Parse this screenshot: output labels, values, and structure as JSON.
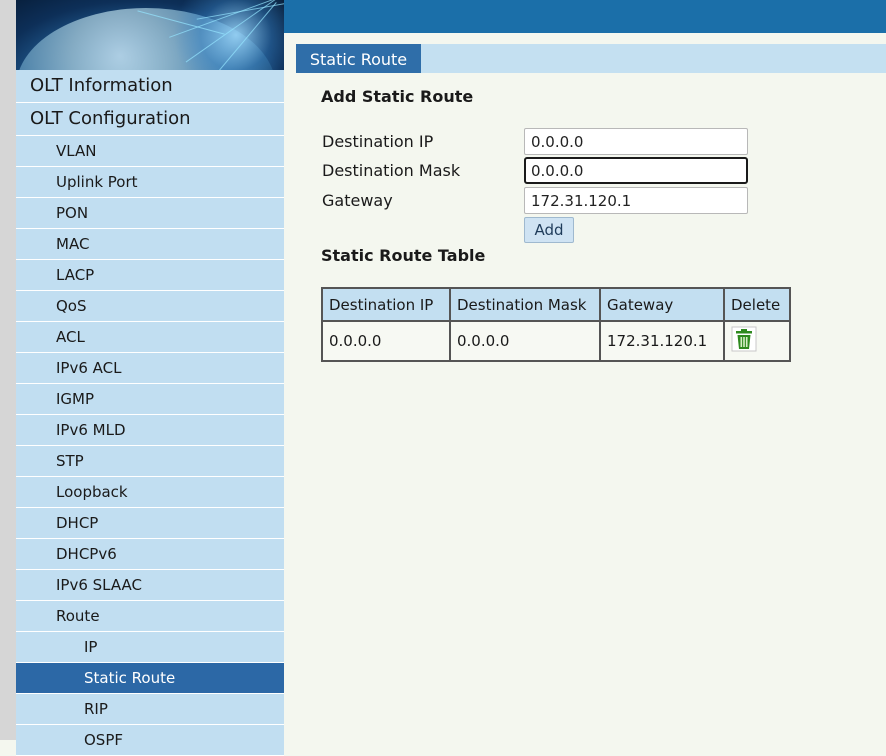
{
  "colors": {
    "accent": "#2c68a6",
    "sidebar_bg": "#c1def1",
    "topbar": "#1b6fa9",
    "page_bg": "#f4f7ef",
    "delete_icon": "#2f8a1f"
  },
  "sidebar": {
    "items": [
      {
        "label": "OLT Information",
        "level": 0,
        "active": false
      },
      {
        "label": "OLT Configuration",
        "level": 0,
        "active": false
      },
      {
        "label": "VLAN",
        "level": 1,
        "active": false
      },
      {
        "label": "Uplink Port",
        "level": 1,
        "active": false
      },
      {
        "label": "PON",
        "level": 1,
        "active": false
      },
      {
        "label": "MAC",
        "level": 1,
        "active": false
      },
      {
        "label": "LACP",
        "level": 1,
        "active": false
      },
      {
        "label": "QoS",
        "level": 1,
        "active": false
      },
      {
        "label": "ACL",
        "level": 1,
        "active": false
      },
      {
        "label": "IPv6 ACL",
        "level": 1,
        "active": false
      },
      {
        "label": "IGMP",
        "level": 1,
        "active": false
      },
      {
        "label": "IPv6 MLD",
        "level": 1,
        "active": false
      },
      {
        "label": "STP",
        "level": 1,
        "active": false
      },
      {
        "label": "Loopback",
        "level": 1,
        "active": false
      },
      {
        "label": "DHCP",
        "level": 1,
        "active": false
      },
      {
        "label": "DHCPv6",
        "level": 1,
        "active": false
      },
      {
        "label": "IPv6 SLAAC",
        "level": 1,
        "active": false
      },
      {
        "label": "Route",
        "level": 1,
        "active": false
      },
      {
        "label": "IP",
        "level": 2,
        "active": false
      },
      {
        "label": "Static Route",
        "level": 2,
        "active": true
      },
      {
        "label": "RIP",
        "level": 2,
        "active": false
      },
      {
        "label": "OSPF",
        "level": 2,
        "active": false
      }
    ]
  },
  "main": {
    "tab": "Static Route",
    "add_section_title": "Add Static Route",
    "form": {
      "destination_ip": {
        "label": "Destination IP",
        "value": "0.0.0.0"
      },
      "destination_mask": {
        "label": "Destination Mask",
        "value": "0.0.0.0"
      },
      "gateway": {
        "label": "Gateway",
        "value": "172.31.120.1"
      },
      "add_label": "Add"
    },
    "table_title": "Static Route Table",
    "table": {
      "headers": [
        "Destination IP",
        "Destination Mask",
        "Gateway",
        "Delete"
      ],
      "rows": [
        {
          "destination_ip": "0.0.0.0",
          "destination_mask": "0.0.0.0",
          "gateway": "172.31.120.1",
          "delete_icon": "trash-icon"
        }
      ]
    }
  }
}
